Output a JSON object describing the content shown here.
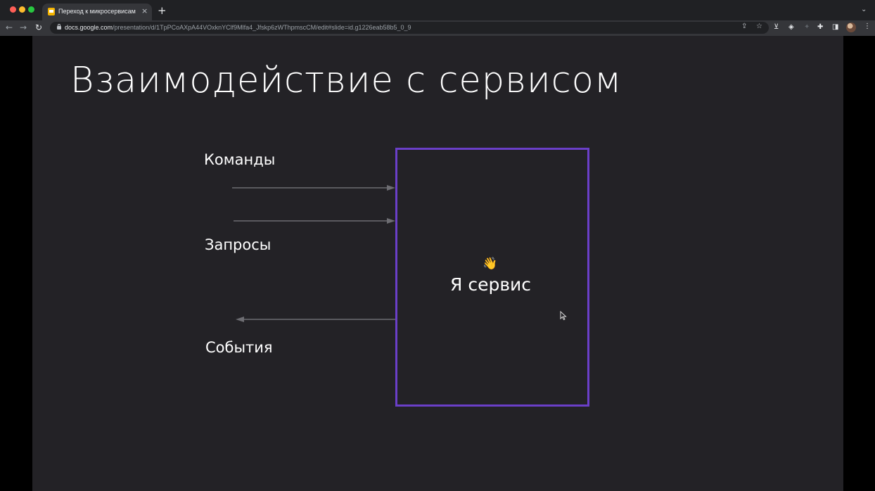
{
  "browser": {
    "tab_title": "Переход к микросервисам - Google Slides",
    "tab_close": "×",
    "new_tab": "+",
    "url_host": "docs.google.com",
    "url_path": "/presentation/d/1TpPCoAXpA44VOxknYClf9Mlfa4_Jfskp6zWThpmscCM/edit#slide=id.g1226eab58b5_0_9"
  },
  "slide": {
    "title": "Взаимодействие с сервисом",
    "commands": "Команды",
    "queries": "Запросы",
    "events": "События",
    "service_emoji": "👋",
    "service_label": "Я сервис"
  },
  "colors": {
    "slide_bg": "#232226",
    "box_border": "#6a3fc8",
    "arrow": "#6d6d72"
  }
}
